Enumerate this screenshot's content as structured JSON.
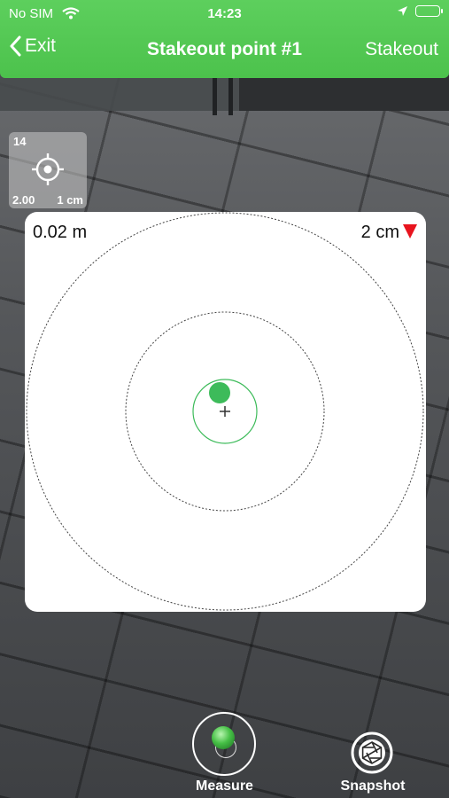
{
  "status_bar": {
    "carrier": "No SIM",
    "time": "14:23"
  },
  "nav": {
    "back_label": "Exit",
    "title": "Stakeout point #1",
    "right_label": "Stakeout"
  },
  "accuracy_widget": {
    "count": "14",
    "left_value": "2.00",
    "right_value": "1 cm"
  },
  "panel": {
    "distance": "0.02 m",
    "tolerance": "2 cm"
  },
  "actions": {
    "measure_label": "Measure",
    "snapshot_label": "Snapshot"
  },
  "colors": {
    "accent_green": "#4cc24c",
    "target_green": "#3dbb5a",
    "alert_red": "#e8141e"
  },
  "icons": [
    "wifi-icon",
    "location-arrow-icon",
    "battery-icon",
    "chevron-left-icon",
    "crosshair-icon",
    "warning-triangle-icon",
    "camera-shutter-icon"
  ]
}
